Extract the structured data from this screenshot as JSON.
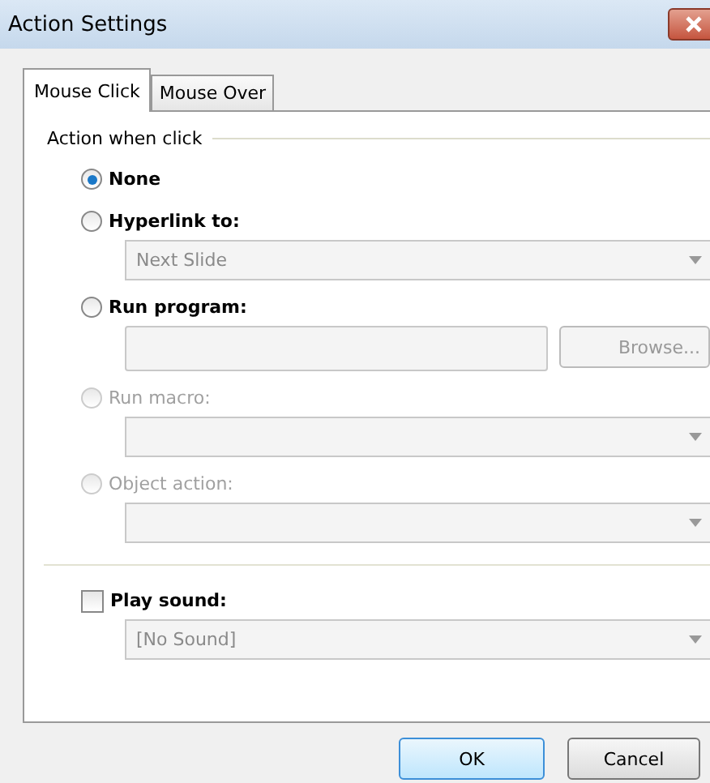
{
  "window": {
    "title": "Action Settings"
  },
  "tabs": [
    {
      "label": "Mouse Click",
      "selected": true
    },
    {
      "label": "Mouse Over",
      "selected": false
    }
  ],
  "group": {
    "title": "Action when click",
    "options": [
      {
        "label": "None",
        "selected": true,
        "disabled": false
      },
      {
        "label": "Hyperlink to:",
        "selected": false,
        "disabled": false,
        "dropdown": {
          "value": "Next Slide",
          "disabled": true
        }
      },
      {
        "label": "Run program:",
        "selected": false,
        "disabled": false,
        "field": {
          "disabled": true
        },
        "browse": {
          "label": "Browse...",
          "disabled": true
        }
      },
      {
        "label": "Run macro:",
        "selected": false,
        "disabled": true,
        "dropdown": {
          "disabled": true
        }
      },
      {
        "label": "Object action:",
        "selected": false,
        "disabled": true,
        "dropdown": {
          "disabled": true
        }
      }
    ]
  },
  "play_sound": {
    "label": "Play sound:",
    "checked": false,
    "dropdown": {
      "value": "[No Sound]",
      "disabled": true
    }
  },
  "buttons": [
    {
      "label": "OK",
      "default": true
    },
    {
      "label": "Cancel",
      "default": false
    }
  ]
}
